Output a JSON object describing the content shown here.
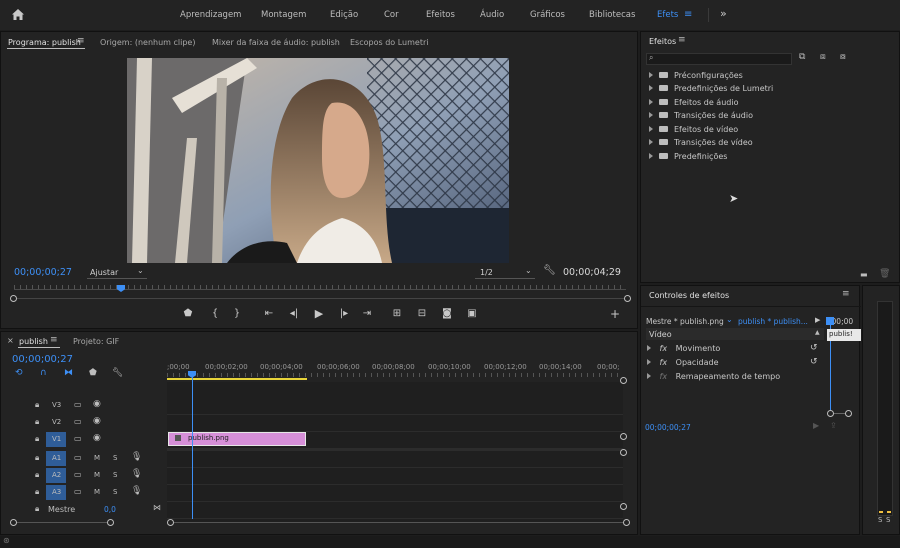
{
  "workspaces": {
    "home_icon": "home-icon",
    "items": [
      "Aprendizagem",
      "Montagem",
      "Edição",
      "Cor",
      "Efeitos",
      "Áudio",
      "Gráficos",
      "Bibliotecas",
      "Efets"
    ],
    "active": "Efets",
    "overflow_icon": "chevron-double-right-icon"
  },
  "program_monitor": {
    "tabs": [
      "Programa: publish",
      "Origem: (nenhum clipe)",
      "Mixer da faixa de áudio: publish",
      "Escopos do Lumetri"
    ],
    "active_tab": "Programa: publish",
    "timecode_current": "00;00;00;27",
    "zoom_select": "Ajustar",
    "resolution_select": "1/2",
    "timecode_duration": "00;00;04;29",
    "playhead_fraction": 0.175,
    "video_description_only": "woman portrait near chain-link fence"
  },
  "effects_panel": {
    "title": "Efeitos",
    "search_placeholder": "",
    "items": [
      "Préconfigurações",
      "Predefinições de Lumetri",
      "Efeitos de áudio",
      "Transições de áudio",
      "Efeitos de vídeo",
      "Transições de vídeo",
      "Predefinições"
    ]
  },
  "effect_controls": {
    "title": "Controles de efeitos",
    "source_label": "Mestre * publish.png",
    "clip_label": "publish * publish...",
    "timecode_right": ";00;00",
    "clip_tag": "publis!",
    "section": "Vídeo",
    "effects": [
      {
        "fx": "fx",
        "name": "Movimento"
      },
      {
        "fx": "fx",
        "name": "Opacidade"
      },
      {
        "fx": "fx",
        "name": "Remapeamento de tempo"
      }
    ],
    "timecode_bottom": "00;00;00;27"
  },
  "timeline": {
    "tabs": [
      "publish",
      "Projeto: GIF"
    ],
    "active_tab": "publish",
    "timecode": "00;00;00;27",
    "ruler_ticks": [
      ";00;00",
      "00;00;02;00",
      "00;00;04;00",
      "00;00;06;00",
      "00;00;08;00",
      "00;00;10;00",
      "00;00;12;00",
      "00;00;14;00",
      "00;00;"
    ],
    "video_tracks": [
      "V3",
      "V2",
      "V1"
    ],
    "audio_tracks": [
      "A1",
      "A2",
      "A3"
    ],
    "track_buttons": {
      "mute": "M",
      "solo": "S"
    },
    "master_label": "Mestre",
    "master_value": "0,0",
    "clip_name": "publish.png"
  },
  "audio_meter": {
    "labels": [
      "S",
      "S"
    ]
  }
}
